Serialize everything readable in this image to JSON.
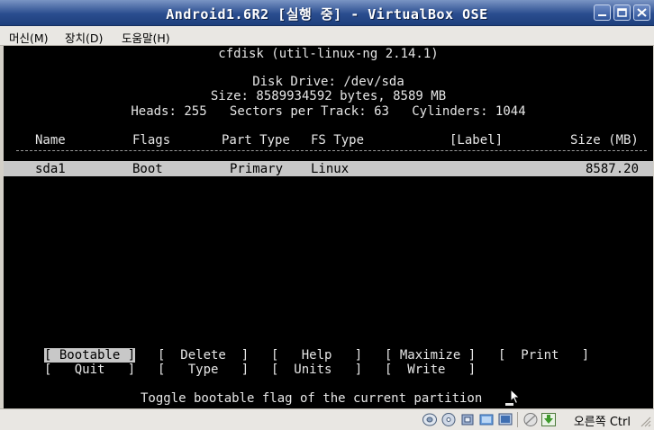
{
  "window": {
    "title": "Android1.6R2 [실행 중] - VirtualBox OSE"
  },
  "menu": [
    {
      "label": "머신(M)"
    },
    {
      "label": "장치(D)"
    },
    {
      "label": "도움말(H)"
    }
  ],
  "console": {
    "header": "cfdisk (util-linux-ng 2.14.1)",
    "disk_drive": "Disk Drive: /dev/sda",
    "size_line": "Size: 8589934592 bytes, 8589 MB",
    "geometry_line": "Heads: 255   Sectors per Track: 63   Cylinders: 1044",
    "columns": [
      "Name",
      "Flags",
      "Part Type",
      "FS Type",
      "[Label]",
      "Size (MB)"
    ],
    "partitions": [
      {
        "name": "sda1",
        "flags": "Boot",
        "part_type": "Primary",
        "fs_type": "Linux",
        "label": "",
        "size": "8587.20"
      }
    ],
    "menu_row1": [
      "[ Bootable ]",
      "[  Delete  ]",
      "[   Help   ]",
      "[ Maximize ]",
      "[  Print   ]"
    ],
    "menu_row2": [
      "[   Quit   ]",
      "[   Type   ]",
      "[  Units   ]",
      "[  Write   ]"
    ],
    "status_message": "Toggle bootable flag of the current partition"
  },
  "statusbar": {
    "host_key": "오른쪽 Ctrl",
    "icons": [
      "hard-disk-icon",
      "cd-rom-icon",
      "usb-icon",
      "shared-folders-icon",
      "network-icon",
      "display-icon",
      "mouse-integration-icon",
      "green-arrow-icon"
    ]
  }
}
